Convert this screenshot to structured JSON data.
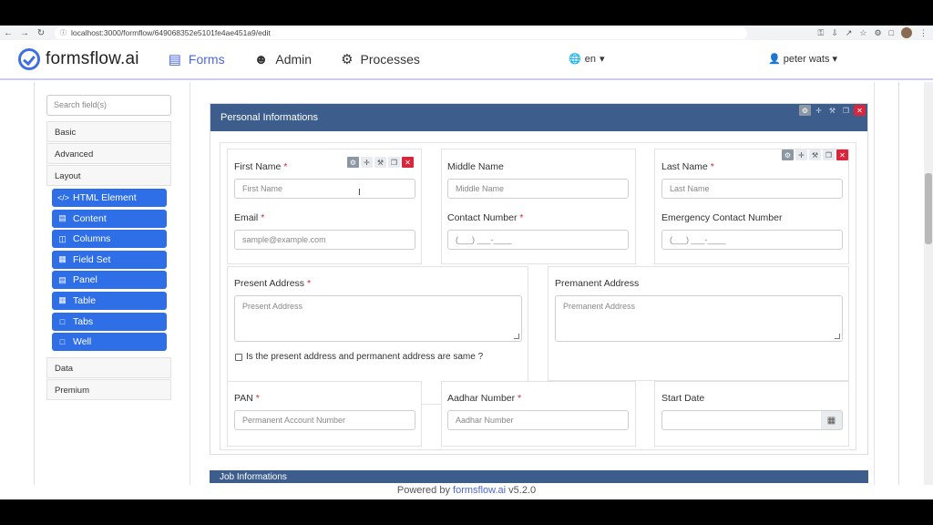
{
  "browser": {
    "url": "localhost:3000/formflow/649068352e5101fe4ae451a9/edit"
  },
  "nav": {
    "brand": "formsflow.ai",
    "items": [
      {
        "label": "Forms",
        "icon": "forms-icon"
      },
      {
        "label": "Admin",
        "icon": "user-circle-icon"
      },
      {
        "label": "Processes",
        "icon": "cogs-icon"
      }
    ],
    "language": "en",
    "user": "peter wats"
  },
  "sidebar": {
    "search_placeholder": "Search field(s)",
    "groups": [
      "Basic",
      "Advanced",
      "Layout",
      "Data",
      "Premium"
    ],
    "layout_components": [
      {
        "label": "HTML Element",
        "icon": "code-icon"
      },
      {
        "label": "Content",
        "icon": "file-icon"
      },
      {
        "label": "Columns",
        "icon": "columns-icon"
      },
      {
        "label": "Field Set",
        "icon": "grid-icon"
      },
      {
        "label": "Panel",
        "icon": "list-alt-icon"
      },
      {
        "label": "Table",
        "icon": "table-icon"
      },
      {
        "label": "Tabs",
        "icon": "folder-icon"
      },
      {
        "label": "Well",
        "icon": "square-icon"
      }
    ]
  },
  "panel": {
    "title": "Personal Informations",
    "fields": {
      "first_name": {
        "label": "First Name",
        "placeholder": "First Name",
        "required": "*"
      },
      "middle_name": {
        "label": "Middle Name",
        "placeholder": "Middle Name"
      },
      "last_name": {
        "label": "Last Name",
        "placeholder": "Last Name",
        "required": "*"
      },
      "email": {
        "label": "Email",
        "placeholder": "sample@example.com",
        "required": "*"
      },
      "contact_number": {
        "label": "Contact Number",
        "placeholder": "(___) ___-____",
        "required": "*"
      },
      "emergency_contact": {
        "label": "Emergency Contact Number",
        "placeholder": "(___) ___-____"
      },
      "present_address": {
        "label": "Present Address",
        "placeholder": "Present Address",
        "required": "*"
      },
      "permanent_address": {
        "label": "Premanent Address",
        "placeholder": "Premanent Address"
      },
      "same_address": {
        "label": "Is the present address and permanent address are same ?"
      },
      "pan": {
        "label": "PAN",
        "placeholder": "Permanent Account Number",
        "required": "*"
      },
      "aadhar": {
        "label": "Aadhar Number",
        "placeholder": "Aadhar Number",
        "required": "*"
      },
      "start_date": {
        "label": "Start Date",
        "placeholder": ""
      }
    }
  },
  "next_panel": {
    "title": "Job Informations"
  },
  "footer": {
    "prefix": "Powered by",
    "brand": "formsflow.ai",
    "version": "v5.2.0"
  },
  "colors": {
    "panel_header": "#3d5e8c",
    "component_button": "#2e6ee6",
    "accent": "#4a67d6",
    "required": "#d9263d"
  }
}
